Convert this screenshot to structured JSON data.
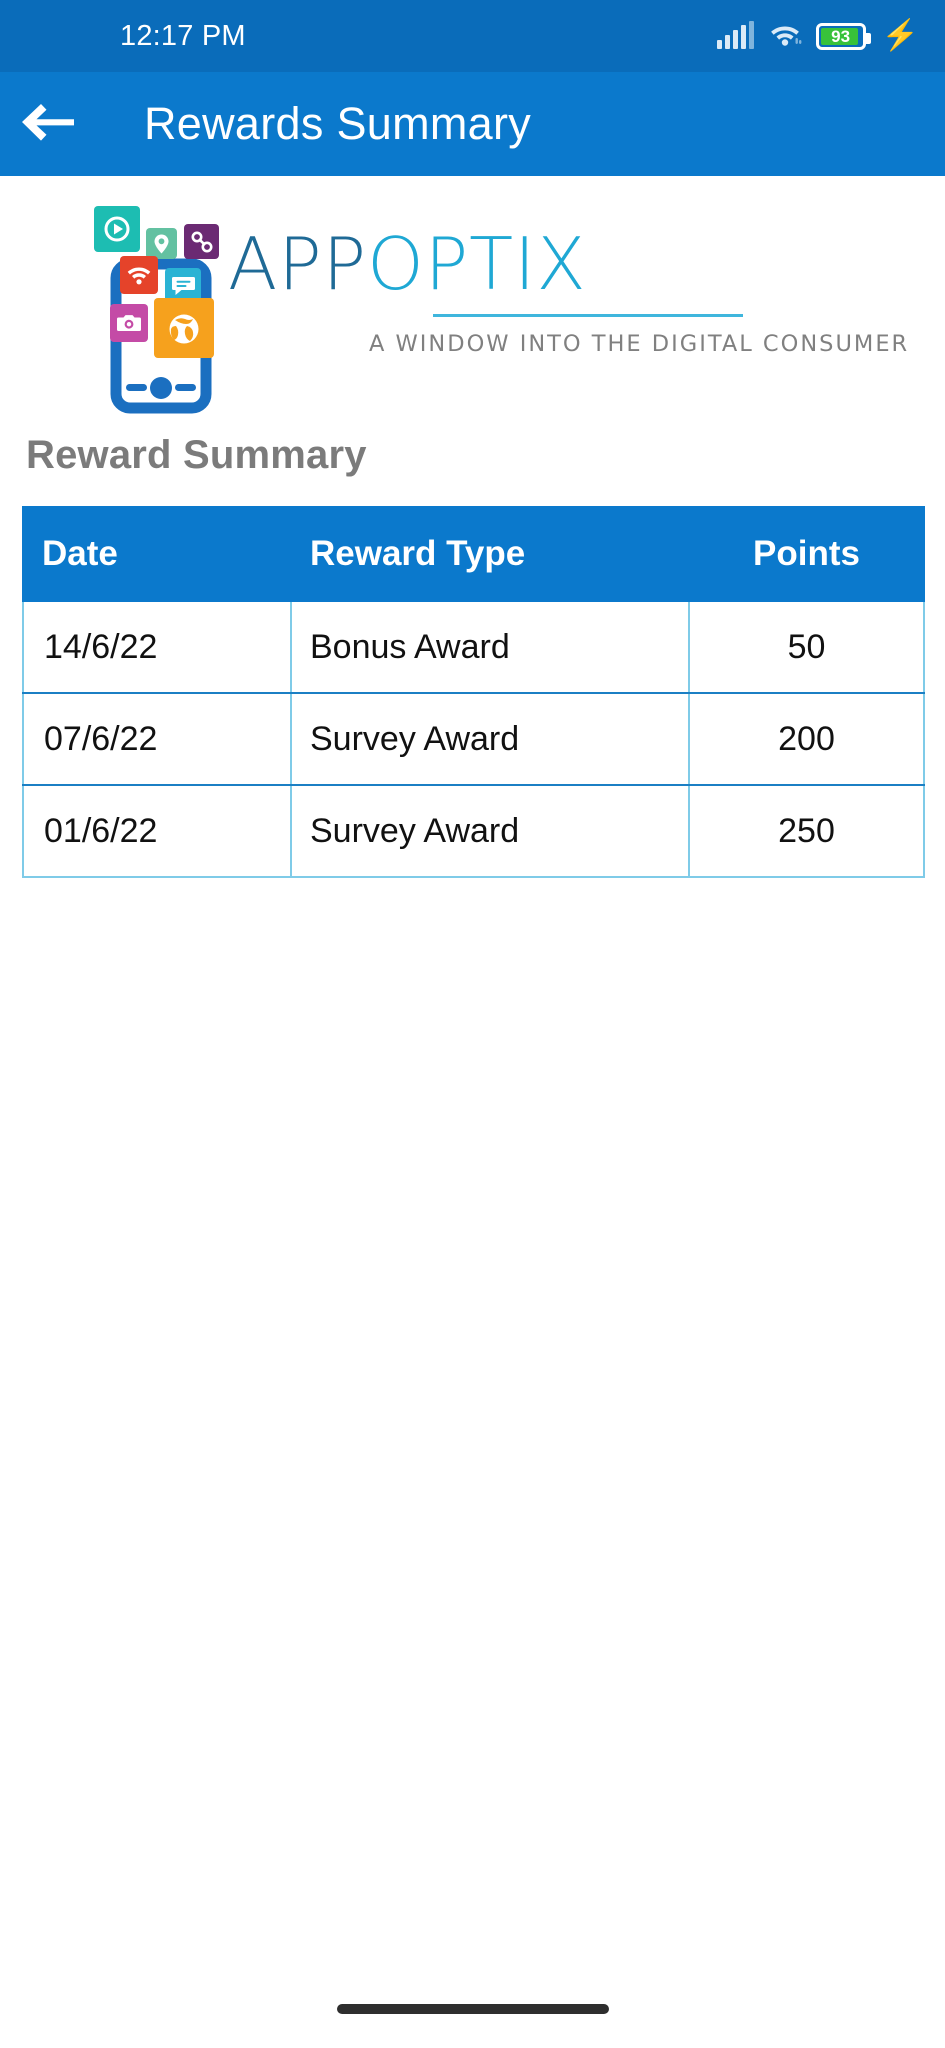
{
  "status_bar": {
    "time": "12:17 PM",
    "battery_percent": "93",
    "icons": [
      "signal-icon",
      "wifi-icon",
      "battery-icon",
      "charging-bolt-icon"
    ]
  },
  "app_bar": {
    "back_icon": "back-arrow-icon",
    "title": "Rewards Summary"
  },
  "logo": {
    "brand_part1": "APP",
    "brand_part2": "OPTIX",
    "tagline": "A WINDOW INTO THE DIGITAL CONSUMER",
    "tiles": [
      {
        "name": "play-icon",
        "color": "#1dbdb2"
      },
      {
        "name": "location-pin-icon",
        "color": "#63c1a1"
      },
      {
        "name": "link-icon",
        "color": "#6b2a73"
      },
      {
        "name": "wifi-icon",
        "color": "#e5432a"
      },
      {
        "name": "chat-bubble-icon",
        "color": "#2ab3d4"
      },
      {
        "name": "camera-icon",
        "color": "#c44ba6"
      },
      {
        "name": "globe-icon",
        "color": "#f6a11d"
      }
    ],
    "phone_icon": "smartphone-icon"
  },
  "section": {
    "title": "Reward Summary"
  },
  "table": {
    "columns": [
      "Date",
      "Reward Type",
      "Points"
    ],
    "rows": [
      {
        "date": "14/6/22",
        "type": "Bonus Award",
        "points": "50"
      },
      {
        "date": "07/6/22",
        "type": "Survey Award",
        "points": "200"
      },
      {
        "date": "01/6/22",
        "type": "Survey Award",
        "points": "250"
      }
    ]
  },
  "colors": {
    "status_bar": "#0a6cba",
    "app_bar": "#0b79cc",
    "table_header": "#0b79cc",
    "table_border": "#7fcbe8",
    "row_divider": "#1b7fc4",
    "heading_text": "#7b7b7b",
    "brand_dark": "#1f6a96",
    "brand_light": "#1fa8d4",
    "battery_fill": "#38c23a"
  }
}
